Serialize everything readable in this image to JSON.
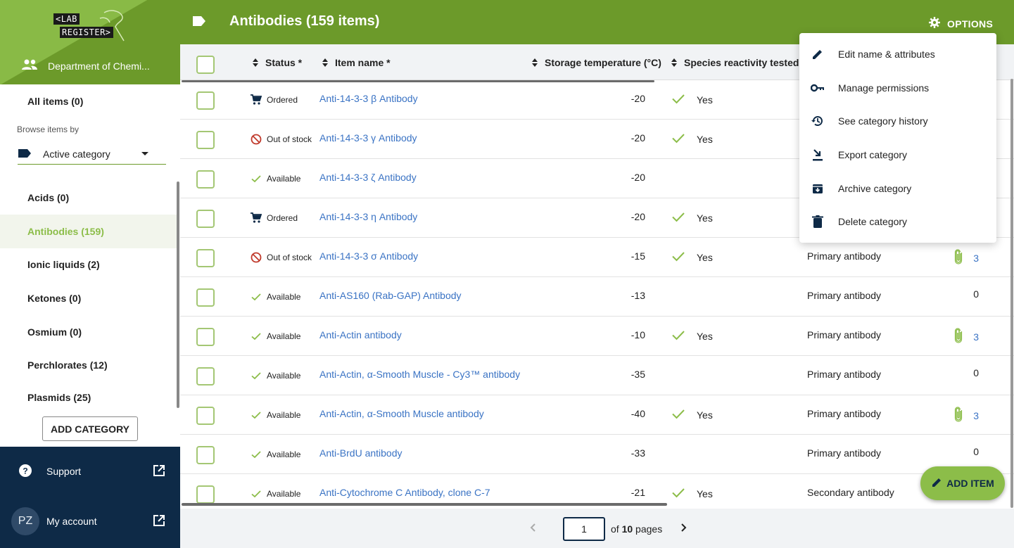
{
  "app": {
    "logo_line1": "<LAB",
    "logo_line2": "REGISTER>",
    "department": "Department of Chemi..."
  },
  "sidebar": {
    "all_items": "All items (0)",
    "browse_label": "Browse items by",
    "browse_select": "Active category",
    "categories": [
      {
        "label": "Acids (0)",
        "active": false
      },
      {
        "label": "Antibodies (159)",
        "active": true
      },
      {
        "label": "Ionic liquids (2)",
        "active": false
      },
      {
        "label": "Ketones (0)",
        "active": false
      },
      {
        "label": "Osmium (0)",
        "active": false
      },
      {
        "label": "Perchlorates (12)",
        "active": false
      },
      {
        "label": "Plasmids (25)",
        "active": false
      }
    ],
    "add_category": "ADD CATEGORY",
    "support": "Support",
    "account": "My account",
    "avatar_initials": "PZ"
  },
  "header": {
    "title": "Antibodies (159 items)",
    "options_label": "OPTIONS"
  },
  "options_menu": [
    {
      "label": "Edit name & attributes",
      "icon": "pencil-icon"
    },
    {
      "label": "Manage permissions",
      "icon": "key-icon"
    },
    {
      "label": "See category history",
      "icon": "history-icon"
    },
    {
      "label": "Export category",
      "icon": "export-icon"
    },
    {
      "label": "Archive category",
      "icon": "archive-icon"
    },
    {
      "label": "Delete category",
      "icon": "trash-icon"
    }
  ],
  "table": {
    "columns": [
      "Status *",
      "Item name *",
      "Storage temperature (°C)",
      "Species reactivity tested"
    ],
    "rows": [
      {
        "status": "Ordered",
        "name": "Anti-14-3-3 β Antibody",
        "temp": "-20",
        "tested": "Yes",
        "type": "",
        "attachments": ""
      },
      {
        "status": "Out of stock",
        "name": "Anti-14-3-3 γ Antibody",
        "temp": "-20",
        "tested": "Yes",
        "type": "",
        "attachments": ""
      },
      {
        "status": "Available",
        "name": "Anti-14-3-3 ζ Antibody",
        "temp": "-20",
        "tested": "",
        "type": "",
        "attachments": ""
      },
      {
        "status": "Ordered",
        "name": "Anti-14-3-3 η Antibody",
        "temp": "-20",
        "tested": "Yes",
        "type": "",
        "attachments": ""
      },
      {
        "status": "Out of stock",
        "name": "Anti-14-3-3 σ Antibody",
        "temp": "-15",
        "tested": "Yes",
        "type": "Primary antibody",
        "attachments": "3"
      },
      {
        "status": "Available",
        "name": "Anti-AS160 (Rab-GAP) Antibody",
        "temp": "-13",
        "tested": "",
        "type": "Primary antibody",
        "attachments": "0"
      },
      {
        "status": "Available",
        "name": "Anti-Actin antibody",
        "temp": "-10",
        "tested": "Yes",
        "type": "Primary antibody",
        "attachments": "3"
      },
      {
        "status": "Available",
        "name": "Anti-Actin, α-Smooth Muscle - Cy3™ antibody",
        "temp": "-35",
        "tested": "",
        "type": "Primary antibody",
        "attachments": "0"
      },
      {
        "status": "Available",
        "name": "Anti-Actin, α-Smooth Muscle antibody",
        "temp": "-40",
        "tested": "Yes",
        "type": "Primary antibody",
        "attachments": "3"
      },
      {
        "status": "Available",
        "name": "Anti-BrdU antibody",
        "temp": "-33",
        "tested": "",
        "type": "Primary antibody",
        "attachments": "0"
      },
      {
        "status": "Available",
        "name": "Anti-Cytochrome C Antibody, clone C-7",
        "temp": "-21",
        "tested": "Yes",
        "type": "Secondary antibody",
        "attachments": ""
      }
    ]
  },
  "pagination": {
    "current_page": "1",
    "of_text": "of",
    "total_pages": "10",
    "pages_text": "pages"
  },
  "fab": {
    "label": "ADD ITEM"
  },
  "colors": {
    "brand_dark": "#6c9a2a",
    "brand_light": "#8cbd49",
    "navy": "#0e2a47",
    "link": "#3a73c4",
    "out_of_stock": "#c0392b"
  }
}
